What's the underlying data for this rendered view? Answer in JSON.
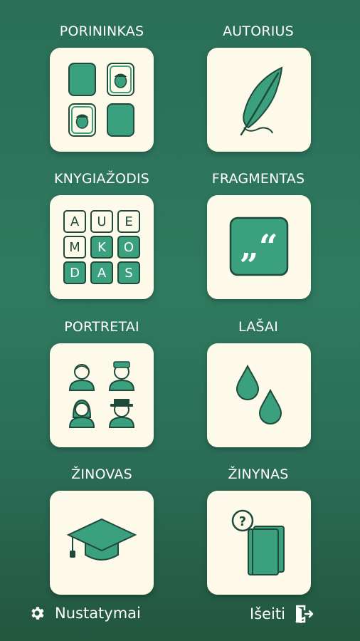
{
  "menu": {
    "porininkas": {
      "label": "PORININKAS"
    },
    "autorius": {
      "label": "AUTORIUS"
    },
    "knygiazodis": {
      "label": "KNYGIAŽODIS",
      "letters": [
        "A",
        "U",
        "E",
        "M",
        "K",
        "O",
        "D",
        "A",
        "S"
      ]
    },
    "fragmentas": {
      "label": "FRAGMENTAS",
      "quote_glyph": "„“"
    },
    "portretai": {
      "label": "PORTRETAI"
    },
    "lasai": {
      "label": "LAŠAI"
    },
    "zinovas": {
      "label": "ŽINOVAS"
    },
    "zinynas": {
      "label": "ŽINYNAS"
    }
  },
  "footer": {
    "settings_label": "Nustatymai",
    "exit_label": "Išeiti"
  },
  "icons": {
    "settings": "gear-icon",
    "exit": "exit-door-icon"
  },
  "colors": {
    "background": "#2a6e57",
    "tile": "#fdfaea",
    "accent": "#3aa07d",
    "outline": "#1f4a3a"
  }
}
